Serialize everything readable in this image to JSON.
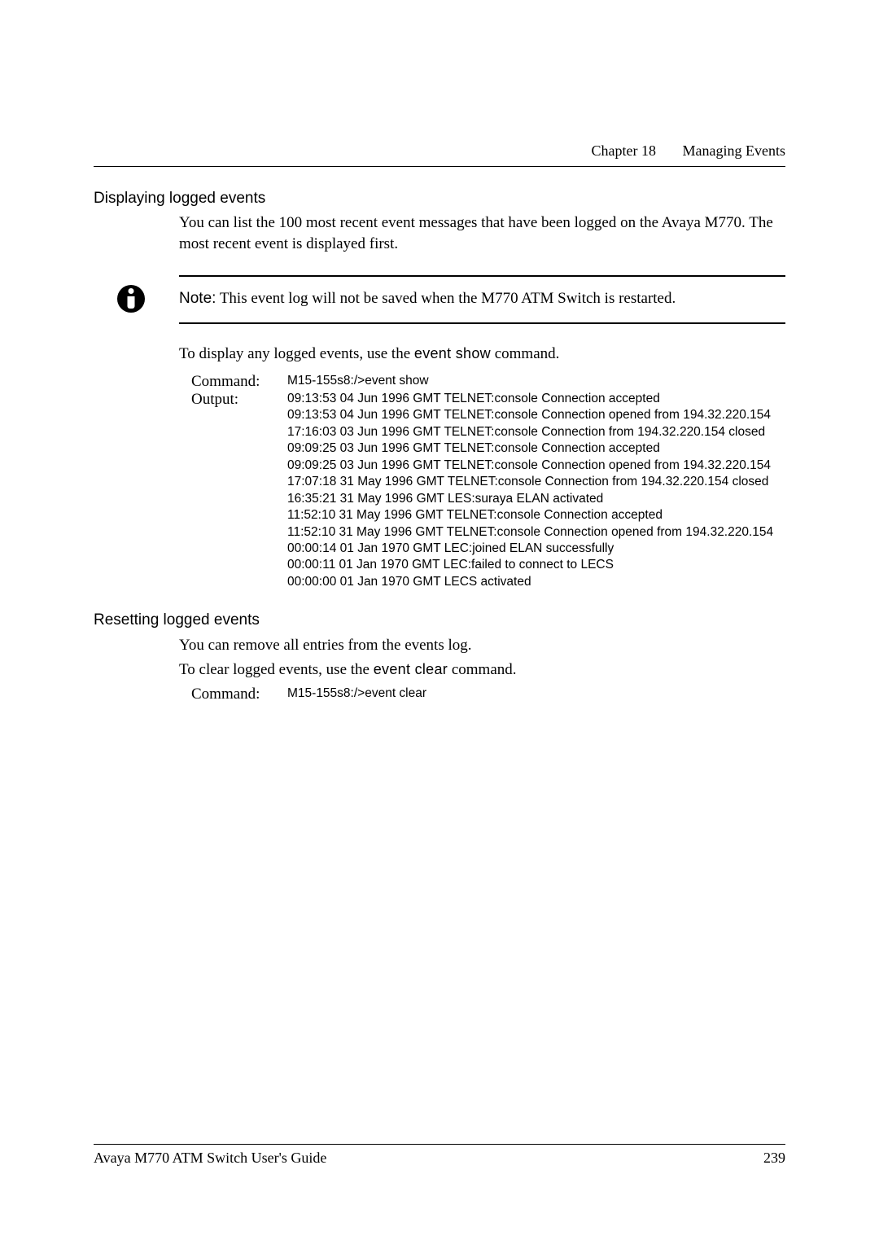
{
  "header": {
    "chapter": "Chapter 18",
    "title": "Managing Events"
  },
  "section1": {
    "title": "Displaying logged events",
    "para": "You can list the 100 most recent event messages that have been logged on the Avaya M770. The most recent event is displayed first.",
    "note_label": "Note:",
    "note_text": " This event log will not be saved when the M770 ATM Switch is restarted.",
    "display_intro_a": "To display any logged events, use the ",
    "display_cmd": "event show",
    "display_intro_b": " command.",
    "cmd_label": "Command:",
    "cmd_value": "M15-155s8:/>event show",
    "out_label": "Output:",
    "output": [
      "09:13:53 04 Jun 1996 GMT TELNET:console Connection accepted",
      "09:13:53 04 Jun 1996 GMT TELNET:console Connection opened from 194.32.220.154",
      "17:16:03 03 Jun 1996 GMT TELNET:console Connection from 194.32.220.154 closed",
      "09:09:25 03 Jun 1996 GMT TELNET:console Connection accepted",
      "09:09:25 03 Jun 1996 GMT TELNET:console Connection opened from 194.32.220.154",
      "17:07:18 31 May 1996 GMT TELNET:console Connection from 194.32.220.154 closed",
      "16:35:21 31 May 1996 GMT LES:suraya ELAN activated",
      "11:52:10 31 May 1996 GMT TELNET:console Connection accepted",
      "11:52:10 31 May 1996 GMT TELNET:console Connection opened from 194.32.220.154",
      "00:00:14 01 Jan 1970 GMT LEC:joined ELAN successfully",
      "00:00:11 01 Jan 1970 GMT LEC:failed to connect to LECS",
      "00:00:00 01 Jan 1970 GMT LECS activated"
    ]
  },
  "section2": {
    "title": "Resetting logged events",
    "para1": "You can remove all entries from the events log.",
    "clear_intro_a": "To clear logged events, use the ",
    "clear_cmd": "event clear",
    "clear_intro_b": " command.",
    "cmd_label": "Command:",
    "cmd_value": "M15-155s8:/>event clear"
  },
  "footer": {
    "left": "Avaya M770 ATM Switch User's Guide",
    "right": "239"
  }
}
